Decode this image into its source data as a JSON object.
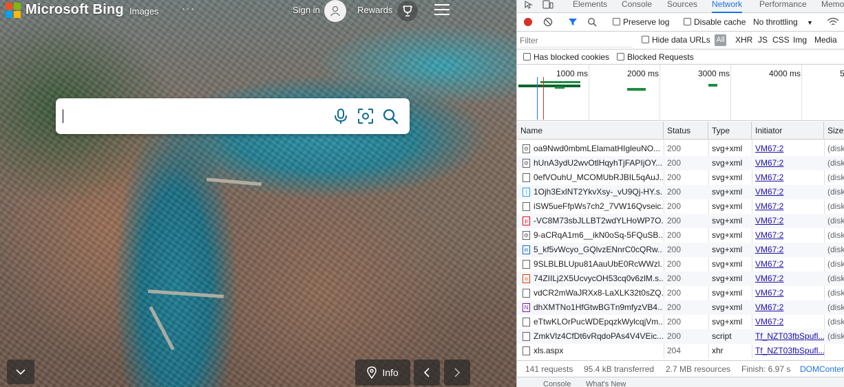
{
  "bing": {
    "logo_text": "Microsoft Bing",
    "nav_images": "Images",
    "nav_more": "···",
    "signin_label": "Sign in",
    "rewards_label": "Rewards",
    "search_placeholder": "",
    "info_label": "Info",
    "icons": [
      "microsoft-logo-icon",
      "user-avatar-icon",
      "trophy-icon",
      "hamburger-menu-icon",
      "microphone-icon",
      "visual-search-icon",
      "search-icon",
      "chevron-down-icon",
      "location-pin-icon",
      "chevron-left-icon",
      "chevron-right-icon"
    ],
    "colors": {
      "accent": "#0f6b8f",
      "logo_red": "#f25022",
      "logo_green": "#7fba00",
      "logo_blue": "#00a4ef",
      "logo_yellow": "#ffb900"
    }
  },
  "devtools": {
    "tabs": [
      "Elements",
      "Console",
      "Sources",
      "Network",
      "Performance",
      "Memo"
    ],
    "active_tab": "Network",
    "toolbar": {
      "preserve_log": "Preserve log",
      "disable_cache": "Disable cache",
      "throttling": "No throttling"
    },
    "filter": {
      "placeholder": "Filter",
      "hide_data_urls": "Hide data URLs",
      "all": "All",
      "types": [
        "XHR",
        "JS",
        "CSS",
        "Img",
        "Media"
      ]
    },
    "blocked": {
      "has_blocked_cookies": "Has blocked cookies",
      "blocked_requests": "Blocked Requests"
    },
    "timeline_labels": [
      "1000 ms",
      "2000 ms",
      "3000 ms",
      "4000 ms",
      "5"
    ],
    "columns": [
      "Name",
      "Status",
      "Type",
      "Initiator",
      "Size"
    ],
    "rows": [
      {
        "name": "oa9Nwd0mbmLElamatHIgleuNO...",
        "status": "200",
        "type": "svg+xml",
        "initiator": "VM67:2",
        "size": "(disk",
        "icon": "gear"
      },
      {
        "name": "hUnA3ydU2wvOtlHqyhTjFAPIjOY...",
        "status": "200",
        "type": "svg+xml",
        "initiator": "VM67:2",
        "size": "(disk",
        "icon": "gear"
      },
      {
        "name": "0efVOuhU_MCOMUbRJBIL5qAuJ...",
        "status": "200",
        "type": "svg+xml",
        "initiator": "VM67:2",
        "size": "(disk",
        "icon": "blank"
      },
      {
        "name": "1Ojh3ExlNT2YkvXsy-_vU9Qj-HY.s...",
        "status": "200",
        "type": "svg+xml",
        "initiator": "VM67:2",
        "size": "(disk",
        "icon": "twitter"
      },
      {
        "name": "iSW5ueFfpWs7ch2_7VW16Qvseic...",
        "status": "200",
        "type": "svg+xml",
        "initiator": "VM67:2",
        "size": "(disk",
        "icon": "blank"
      },
      {
        "name": "-VC8M73sbJLLBT2wdYLHoWP7O...",
        "status": "200",
        "type": "svg+xml",
        "initiator": "VM67:2",
        "size": "(disk",
        "icon": "pinterest"
      },
      {
        "name": "9-aCRqA1m6__ikN0oSq-5FQuSB...",
        "status": "200",
        "type": "svg+xml",
        "initiator": "VM67:2",
        "size": "(disk",
        "icon": "gear"
      },
      {
        "name": "5_kf5vWcyo_GQlvzENnrC0cQRw...",
        "status": "200",
        "type": "svg+xml",
        "initiator": "VM67:2",
        "size": "(disk",
        "icon": "linkedin"
      },
      {
        "name": "9SLBLBLUpu81AauUbE0RcWWzl...",
        "status": "200",
        "type": "svg+xml",
        "initiator": "VM67:2",
        "size": "(disk",
        "icon": "blank"
      },
      {
        "name": "74ZIILj2X5UcvycOH53cq0v6zlM.s...",
        "status": "200",
        "type": "svg+xml",
        "initiator": "VM67:2",
        "size": "(disk",
        "icon": "office"
      },
      {
        "name": "vdCR2mWaJRXx8-LaXLK32t0sZQ...",
        "status": "200",
        "type": "svg+xml",
        "initiator": "VM67:2",
        "size": "(disk",
        "icon": "blank"
      },
      {
        "name": "dhXMTNo1HfGtwBGTn9mfyzVB4...",
        "status": "200",
        "type": "svg+xml",
        "initiator": "VM67:2",
        "size": "(disk",
        "icon": "onenote"
      },
      {
        "name": "eTtwKLOrPucWDEpqzkWylcqjVm...",
        "status": "200",
        "type": "svg+xml",
        "initiator": "VM67:2",
        "size": "(disk",
        "icon": "blank"
      },
      {
        "name": "ZmkVlz4CfDt6vRqdoPAs4V4VEic...",
        "status": "200",
        "type": "script",
        "initiator": "Tf_NZT03fbSpufl...",
        "size": "(disk",
        "icon": "doc"
      },
      {
        "name": "xls.aspx",
        "status": "204",
        "type": "xhr",
        "initiator": "Tf_NZT03fbSpufl...",
        "size": "",
        "icon": "doc"
      }
    ],
    "status_bar": {
      "requests": "141 requests",
      "transferred": "95.4 kB transferred",
      "resources": "2.7 MB resources",
      "finish": "Finish: 6.97 s",
      "dom": "DOMConter"
    },
    "drawer_tabs": [
      "Console",
      "What's New"
    ],
    "colors": {
      "active_tab": "#1a73e8",
      "record": "#d93025",
      "link": "#1a0dab"
    }
  }
}
